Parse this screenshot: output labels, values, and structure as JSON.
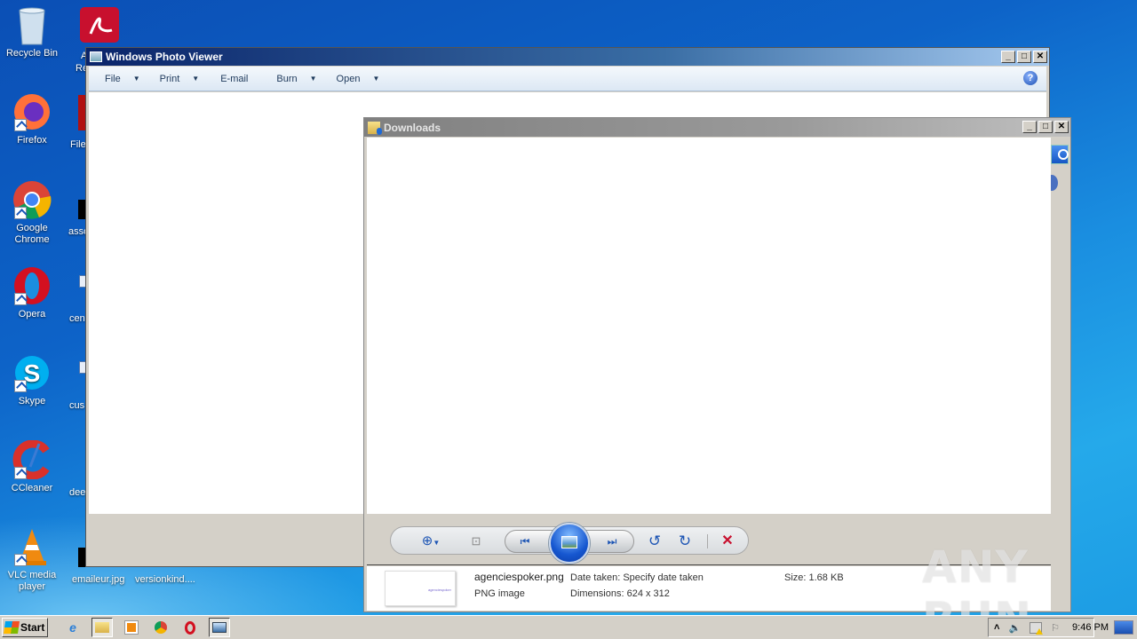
{
  "desktop": {
    "icons": [
      {
        "label": "Recycle Bin",
        "icon": "recycle-bin-icon"
      },
      {
        "label": "Firefox",
        "icon": "firefox-icon"
      },
      {
        "label": "Google Chrome",
        "icon": "chrome-icon"
      },
      {
        "label": "Opera",
        "icon": "opera-icon"
      },
      {
        "label": "Skype",
        "icon": "skype-icon"
      },
      {
        "label": "CCleaner",
        "icon": "ccleaner-icon"
      },
      {
        "label": "VLC media player",
        "icon": "vlc-icon"
      }
    ],
    "partial_icons": [
      {
        "label": "A",
        "label2": "Re",
        "icon": "acrobat-reader-icon"
      },
      {
        "label": "File",
        "icon": "file-icon"
      },
      {
        "label": "asso",
        "icon": "file-icon"
      },
      {
        "label": "cen",
        "icon": "document-icon"
      },
      {
        "label": "cus",
        "icon": "document-icon"
      },
      {
        "label": "dee",
        "icon": "file-icon"
      },
      {
        "label": "emaileur.jpg",
        "icon": "image-icon"
      },
      {
        "label": "versionkind....",
        "icon": "file-icon"
      }
    ]
  },
  "photo_viewer": {
    "title": "Windows Photo Viewer",
    "menu": [
      {
        "label": "File",
        "has_dropdown": true
      },
      {
        "label": "Print",
        "has_dropdown": true
      },
      {
        "label": "E-mail",
        "has_dropdown": false
      },
      {
        "label": "Burn",
        "has_dropdown": true
      },
      {
        "label": "Open",
        "has_dropdown": true
      }
    ],
    "help": "?",
    "window_buttons": {
      "minimize": "_",
      "maximize": "□",
      "close": "✕"
    }
  },
  "downloads": {
    "title": "Downloads",
    "controls": {
      "zoom": "zoom-icon",
      "fit": "actual-size-icon",
      "previous": "previous-icon",
      "slideshow": "slideshow-icon",
      "next": "next-icon",
      "rotate_ccw": "rotate-counterclockwise-icon",
      "rotate_cw": "rotate-clockwise-icon",
      "delete": "delete-icon"
    },
    "file": {
      "name": "agenciespoker.png",
      "type": "PNG image",
      "date_taken": "Date taken: Specify date taken",
      "dimensions": "Dimensions: 624 x 312",
      "size": "Size: 1.68 KB",
      "thumb_text": "agenciespoker"
    }
  },
  "watermark": "ANY RUN",
  "taskbar": {
    "start": "Start",
    "apps": [
      "internet-explorer-icon",
      "explorer-icon",
      "media-player-icon",
      "chrome-icon",
      "opera-icon",
      "photo-viewer-icon"
    ],
    "tray_expand": "˄",
    "clock": "9:46 PM"
  }
}
